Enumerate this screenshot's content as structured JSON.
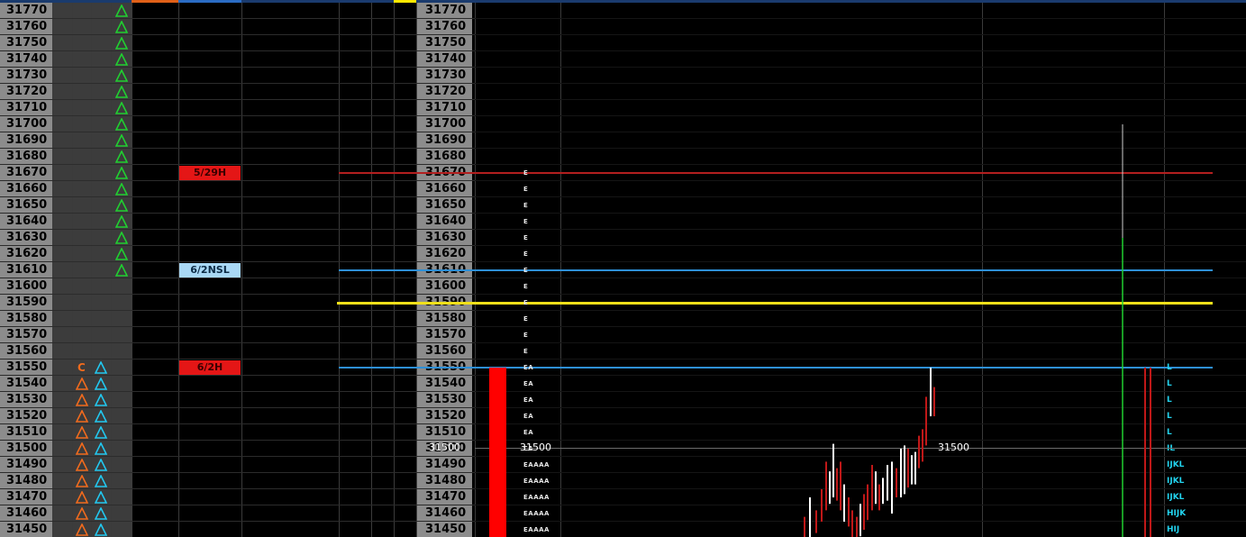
{
  "ladder": {
    "prices": [
      "31770",
      "31760",
      "31750",
      "31740",
      "31730",
      "31720",
      "31710",
      "31700",
      "31690",
      "31680",
      "31670",
      "31660",
      "31650",
      "31640",
      "31630",
      "31620",
      "31610",
      "31600",
      "31590",
      "31580",
      "31570",
      "31560",
      "31550",
      "31540",
      "31530",
      "31520",
      "31510",
      "31500",
      "31490",
      "31480",
      "31470",
      "31460",
      "31450"
    ],
    "green_triangle_rows": [
      "31770",
      "31760",
      "31750",
      "31740",
      "31730",
      "31720",
      "31710",
      "31700",
      "31690",
      "31680",
      "31670",
      "31660",
      "31650",
      "31640",
      "31630",
      "31620",
      "31610"
    ],
    "orange_triangle_rows": [
      "31540",
      "31530",
      "31520",
      "31510",
      "31500",
      "31490",
      "31480",
      "31470",
      "31460",
      "31450"
    ],
    "cyan_triangle_rows": [
      "31550",
      "31540",
      "31530",
      "31520",
      "31510",
      "31500",
      "31490",
      "31480",
      "31470",
      "31460",
      "31450"
    ],
    "c_marker": {
      "price": "31550",
      "text": "C"
    }
  },
  "badges": [
    {
      "price": "31670",
      "text": "5/29H",
      "bg": "#e41616",
      "fg": "#3a0000"
    },
    {
      "price": "31610",
      "text": "6/2NSL",
      "bg": "#a9d8f5",
      "fg": "#0b2a44"
    },
    {
      "price": "31550",
      "text": "6/2H",
      "bg": "#e41616",
      "fg": "#3a0000"
    }
  ],
  "levels": [
    {
      "price": "31670",
      "color": "#b21f1f"
    },
    {
      "price": "31610",
      "color": "#2e8fd6"
    },
    {
      "price": "31590",
      "color": "#f0e01a"
    },
    {
      "price": "31550",
      "color": "#2e8fd6"
    }
  ],
  "tpo_profile": [
    {
      "price": "31670",
      "letters": "E"
    },
    {
      "price": "31660",
      "letters": "E"
    },
    {
      "price": "31650",
      "letters": "E"
    },
    {
      "price": "31640",
      "letters": "E"
    },
    {
      "price": "31630",
      "letters": "E"
    },
    {
      "price": "31620",
      "letters": "E"
    },
    {
      "price": "31610",
      "letters": "E"
    },
    {
      "price": "31600",
      "letters": "E"
    },
    {
      "price": "31590",
      "letters": "E"
    },
    {
      "price": "31580",
      "letters": "E"
    },
    {
      "price": "31570",
      "letters": "E"
    },
    {
      "price": "31560",
      "letters": "E"
    },
    {
      "price": "31550",
      "letters": "EA"
    },
    {
      "price": "31540",
      "letters": "EA"
    },
    {
      "price": "31530",
      "letters": "EA"
    },
    {
      "price": "31520",
      "letters": "EA"
    },
    {
      "price": "31510",
      "letters": "EA"
    },
    {
      "price": "31500",
      "letters": "EA"
    },
    {
      "price": "31490",
      "letters": "EAAAA"
    },
    {
      "price": "31480",
      "letters": "EAAAA"
    },
    {
      "price": "31470",
      "letters": "EAAAA"
    },
    {
      "price": "31460",
      "letters": "EAAAA"
    },
    {
      "price": "31450",
      "letters": "EAAAA"
    }
  ],
  "right_tpo": [
    {
      "price": "31550",
      "letters": "L"
    },
    {
      "price": "31540",
      "letters": "L"
    },
    {
      "price": "31530",
      "letters": "L"
    },
    {
      "price": "31520",
      "letters": "L"
    },
    {
      "price": "31510",
      "letters": "L"
    },
    {
      "price": "31500",
      "letters": "IL"
    },
    {
      "price": "31490",
      "letters": "IJKL"
    },
    {
      "price": "31480",
      "letters": "IJKL"
    },
    {
      "price": "31470",
      "letters": "IJKL"
    },
    {
      "price": "31460",
      "letters": "HIJK"
    },
    {
      "price": "31450",
      "letters": "HIJ"
    }
  ],
  "price_line": {
    "price": "31500",
    "labels": [
      "31500",
      "31500",
      "31500"
    ]
  },
  "colors": {
    "ladder_bg": "#8c8c8c",
    "column_bg": "#3c3c3c",
    "green": "#20d030",
    "orange": "#f26b1d",
    "cyan": "#22c8f0",
    "up_candle": "#ffffff",
    "down_candle": "#c01818",
    "volume_bar": "#ff0000"
  }
}
